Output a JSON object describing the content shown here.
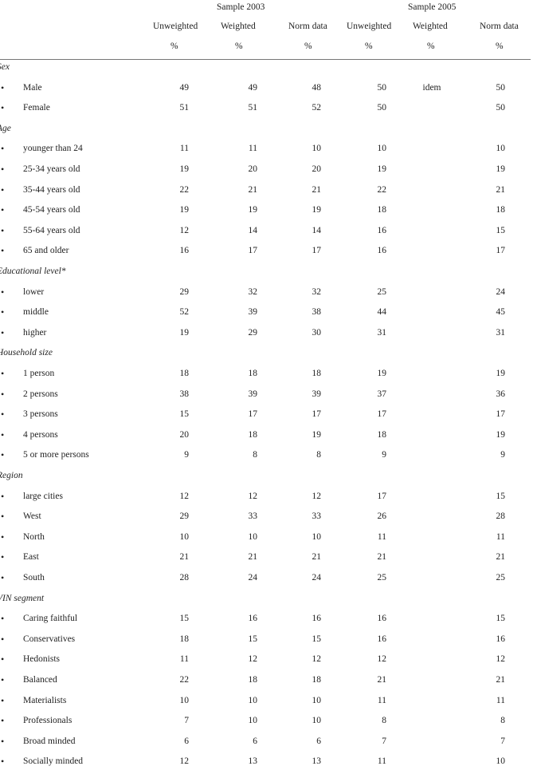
{
  "header": {
    "groups": [
      "Sample  2003",
      "Sample  2005"
    ],
    "columns": [
      "Unweighted",
      "Weighted",
      "Norm data",
      "Unweighted",
      "Weighted",
      "Norm data"
    ],
    "units": [
      "%",
      "%",
      "%",
      "%",
      "%",
      "%"
    ]
  },
  "sections": [
    {
      "title": "Sex",
      "rows": [
        {
          "label": "Male",
          "values": [
            "49",
            "49",
            "48",
            "50",
            "idem",
            "50"
          ]
        },
        {
          "label": "Female",
          "values": [
            "51",
            "51",
            "52",
            "50",
            "",
            "50"
          ]
        }
      ]
    },
    {
      "title": "Age",
      "rows": [
        {
          "label": "younger than 24",
          "values": [
            "11",
            "11",
            "10",
            "10",
            "",
            "10"
          ]
        },
        {
          "label": "25-34 years old",
          "values": [
            "19",
            "20",
            "20",
            "19",
            "",
            "19"
          ]
        },
        {
          "label": "35-44 years old",
          "values": [
            "22",
            "21",
            "21",
            "22",
            "",
            "21"
          ]
        },
        {
          "label": "45-54 years old",
          "values": [
            "19",
            "19",
            "19",
            "18",
            "",
            "18"
          ]
        },
        {
          "label": "55-64 years old",
          "values": [
            "12",
            "14",
            "14",
            "16",
            "",
            "15"
          ]
        },
        {
          "label": "65 and older",
          "values": [
            "16",
            "17",
            "17",
            "16",
            "",
            "17"
          ]
        }
      ]
    },
    {
      "title": "Educational level*",
      "rows": [
        {
          "label": "lower",
          "values": [
            "29",
            "32",
            "32",
            "25",
            "",
            "24"
          ]
        },
        {
          "label": "middle",
          "values": [
            "52",
            "39",
            "38",
            "44",
            "",
            "45"
          ]
        },
        {
          "label": "higher",
          "values": [
            "19",
            "29",
            "30",
            "31",
            "",
            "31"
          ]
        }
      ]
    },
    {
      "title": "Household size",
      "rows": [
        {
          "label": "1 person",
          "values": [
            "18",
            "18",
            "18",
            "19",
            "",
            "19"
          ]
        },
        {
          "label": "2 persons",
          "values": [
            "38",
            "39",
            "39",
            "37",
            "",
            "36"
          ]
        },
        {
          "label": "3 persons",
          "values": [
            "15",
            "17",
            "17",
            "17",
            "",
            "17"
          ]
        },
        {
          "label": "4 persons",
          "values": [
            "20",
            "18",
            "19",
            "18",
            "",
            "19"
          ]
        },
        {
          "label": "5 or more persons",
          "values": [
            "9",
            "8",
            "8",
            "9",
            "",
            "9"
          ]
        }
      ]
    },
    {
      "title": "Region",
      "rows": [
        {
          "label": "large cities",
          "values": [
            "12",
            "12",
            "12",
            "17",
            "",
            "15"
          ]
        },
        {
          "label": "West",
          "values": [
            "29",
            "33",
            "33",
            "26",
            "",
            "28"
          ]
        },
        {
          "label": "North",
          "values": [
            "10",
            "10",
            "10",
            "11",
            "",
            "11"
          ]
        },
        {
          "label": "East",
          "values": [
            "21",
            "21",
            "21",
            "21",
            "",
            "21"
          ]
        },
        {
          "label": "South",
          "values": [
            "28",
            "24",
            "24",
            "25",
            "",
            "25"
          ]
        }
      ]
    },
    {
      "title": "VIN segment",
      "rows": [
        {
          "label": "Caring faithful",
          "values": [
            "15",
            "16",
            "16",
            "16",
            "",
            "15"
          ]
        },
        {
          "label": "Conservatives",
          "values": [
            "18",
            "15",
            "15",
            "16",
            "",
            "16"
          ]
        },
        {
          "label": "Hedonists",
          "values": [
            "11",
            "12",
            "12",
            "12",
            "",
            "12"
          ]
        },
        {
          "label": "Balanced",
          "values": [
            "22",
            "18",
            "18",
            "21",
            "",
            "21"
          ]
        },
        {
          "label": "Materialists",
          "values": [
            "10",
            "10",
            "10",
            "11",
            "",
            "11"
          ]
        },
        {
          "label": "Professionals",
          "values": [
            "7",
            "10",
            "10",
            "8",
            "",
            "8"
          ]
        },
        {
          "label": "Broad minded",
          "values": [
            "6",
            "6",
            "6",
            "7",
            "",
            "7"
          ]
        },
        {
          "label": "Socially minded",
          "values": [
            "12",
            "13",
            "13",
            "11",
            "",
            "10"
          ]
        }
      ]
    }
  ],
  "bullet_glyph": "•"
}
